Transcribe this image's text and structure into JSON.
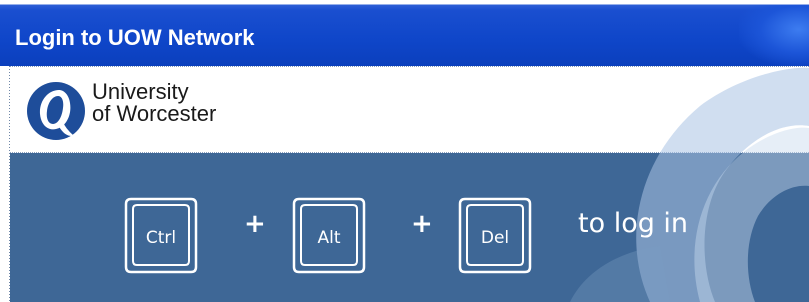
{
  "window": {
    "title": "Login to UOW Network"
  },
  "logo": {
    "line1": "University",
    "line2": "of Worcester"
  },
  "keys": {
    "ctrl": "Ctrl",
    "alt": "Alt",
    "del": "Del",
    "plus1": "+",
    "plus2": "+"
  },
  "hint": "to log in",
  "colors": {
    "title_bar": "#0f46c9",
    "client_background": "#3e6796",
    "logo_blue": "#1e4d9a",
    "swoosh_light": "#a9c3e4"
  },
  "icons": {
    "logo_mark": "university-of-worcester-logo-icon",
    "key_outline": "keyboard-key-icon"
  }
}
